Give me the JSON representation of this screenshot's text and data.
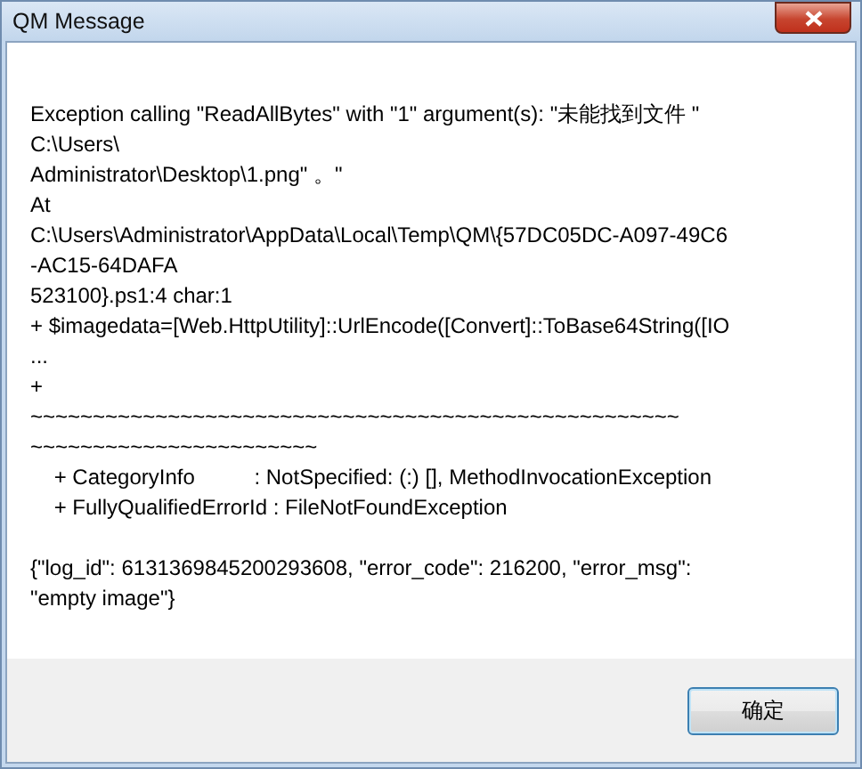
{
  "window": {
    "title": "QM Message"
  },
  "message_blocks": [
    {
      "lines": [
        "Exception calling \"ReadAllBytes\" with \"1\" argument(s): \"未能找到文件 \"",
        "C:\\Users\\",
        "Administrator\\Desktop\\1.png\" 。\"",
        "At",
        "C:\\Users\\Administrator\\AppData\\Local\\Temp\\QM\\{57DC05DC-A097-49C6",
        "-AC15-64DAFA",
        "523100}.ps1:4 char:1",
        "+ $imagedata=[Web.HttpUtility]::UrlEncode([Convert]::ToBase64String([IO",
        "...",
        "+",
        "~~~~~~~~~~~~~~~~~~~~~~~~~~~~~~~~~~~~~~~~~~~~~~~~~~~~",
        "~~~~~~~~~~~~~~~~~~~~~~~",
        "    + CategoryInfo          : NotSpecified: (:) [], MethodInvocationException",
        "    + FullyQualifiedErrorId : FileNotFoundException"
      ]
    },
    {
      "lines": [
        "{\"log_id\": 6131369845200293608, \"error_code\": 216200, \"error_msg\":",
        "\"empty image\"}"
      ]
    }
  ],
  "buttons": [
    "确定"
  ]
}
